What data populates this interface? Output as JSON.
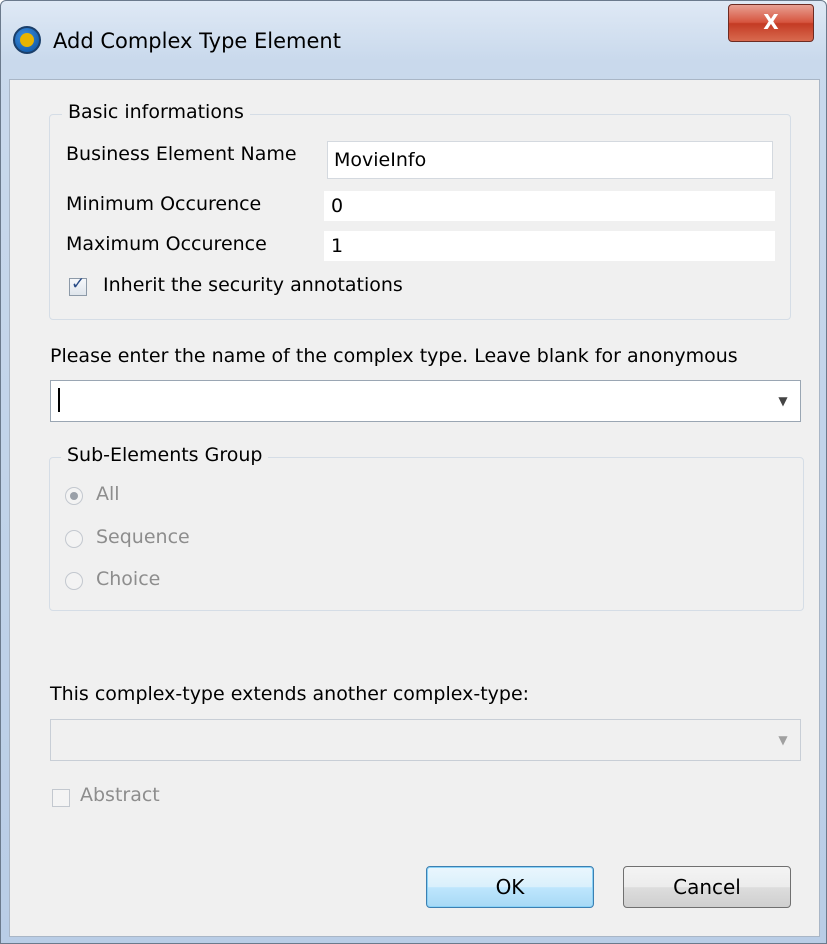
{
  "window": {
    "title": "Add Complex Type Element",
    "close_glyph": "X"
  },
  "basic": {
    "legend": "Basic informations",
    "name_label": "Business Element Name",
    "name_value": "MovieInfo",
    "min_label": "Minimum Occurence",
    "min_value": "0",
    "max_label": "Maximum Occurence",
    "max_value": "1",
    "inherit_label": "Inherit the security annotations",
    "inherit_checked": true
  },
  "complex_type": {
    "prompt": "Please enter the name of the complex type. Leave blank for anonymous",
    "value": ""
  },
  "sub_elements": {
    "legend": "Sub-Elements Group",
    "options": [
      "All",
      "Sequence",
      "Choice"
    ],
    "selected": "All"
  },
  "extends": {
    "label": "This complex-type extends another complex-type:",
    "value": "",
    "abstract_label": "Abstract",
    "abstract_checked": false
  },
  "buttons": {
    "ok": "OK",
    "cancel": "Cancel"
  },
  "icons": {
    "app": "talend-app-icon",
    "close": "close-icon",
    "dropdown": "chevron-down-icon"
  }
}
